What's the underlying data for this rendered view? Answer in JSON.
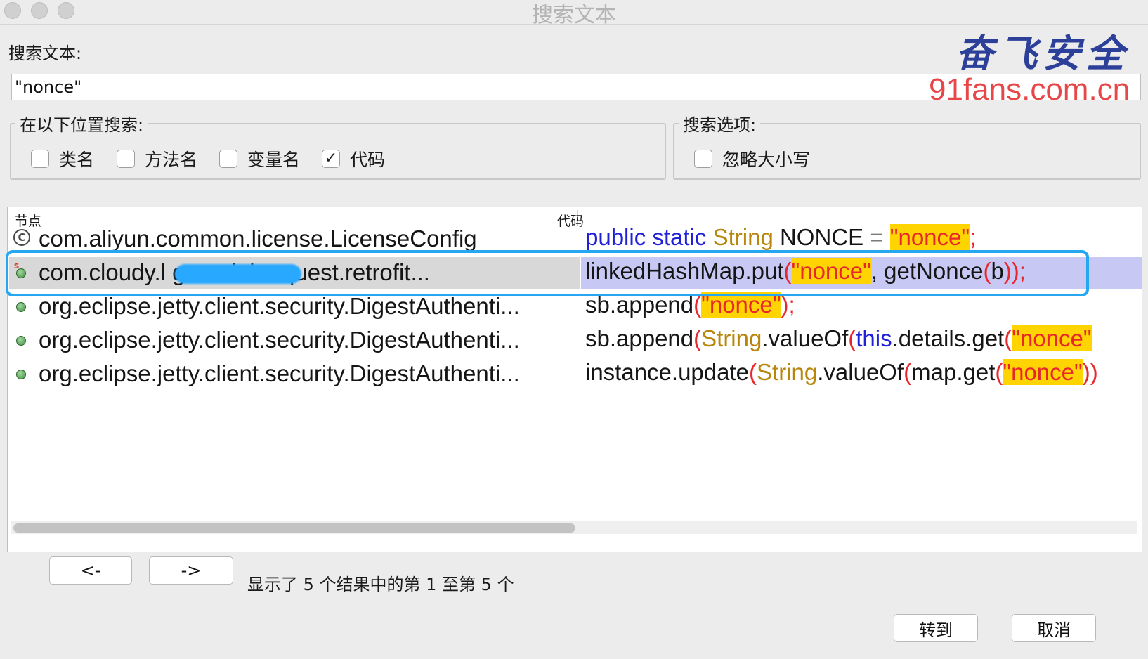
{
  "window": {
    "title": "搜索文本"
  },
  "search": {
    "label": "搜索文本:",
    "value": "\"nonce\""
  },
  "watermark": {
    "brand": "奋飞安全",
    "url": "91fans.com.cn"
  },
  "location_group": {
    "legend": "在以下位置搜索:",
    "options": [
      {
        "label": "类名",
        "checked": false
      },
      {
        "label": "方法名",
        "checked": false
      },
      {
        "label": "变量名",
        "checked": false
      },
      {
        "label": "代码",
        "checked": true
      }
    ]
  },
  "options_group": {
    "legend": "搜索选项:",
    "options": [
      {
        "label": "忽略大小写",
        "checked": false
      }
    ]
  },
  "results": {
    "columns": [
      "节点",
      "代码"
    ],
    "rows": [
      {
        "node": "com.aliyun.common.license.LicenseConfig",
        "icon": "class-icon",
        "code": "public static String NONCE = \"nonce\";",
        "selected": false
      },
      {
        "node": "com.cloudy.l g model.request.retrofit...",
        "icon": "static-method-icon",
        "code": "linkedHashMap.put(\"nonce\", getNonce(b));",
        "selected": true
      },
      {
        "node": "org.eclipse.jetty.client.security.DigestAuthenti...",
        "icon": "method-icon",
        "code": "sb.append(\"nonce\");",
        "selected": false
      },
      {
        "node": "org.eclipse.jetty.client.security.DigestAuthenti...",
        "icon": "method-icon",
        "code": "sb.append(String.valueOf(this.details.get(\"nonce\"",
        "selected": false
      },
      {
        "node": "org.eclipse.jetty.client.security.DigestAuthenti...",
        "icon": "method-icon",
        "code": "instance.update(String.valueOf(map.get(\"nonce\"))",
        "selected": false
      }
    ],
    "code_tokens": [
      [
        {
          "t": "public static ",
          "c": "kw"
        },
        {
          "t": "String ",
          "c": "ty"
        },
        {
          "t": "NONCE ",
          "c": ""
        },
        {
          "t": "= ",
          "c": "op"
        },
        {
          "t": "\"nonce\"",
          "c": "st"
        },
        {
          "t": ";",
          "c": "pn"
        }
      ],
      [
        {
          "t": "linkedHashMap.put",
          "c": ""
        },
        {
          "t": "(",
          "c": "pn"
        },
        {
          "t": "\"nonce\"",
          "c": "st"
        },
        {
          "t": ", getNonce",
          "c": ""
        },
        {
          "t": "(",
          "c": "pn"
        },
        {
          "t": "b",
          "c": ""
        },
        {
          "t": "));",
          "c": "pn"
        }
      ],
      [
        {
          "t": "sb.append",
          "c": ""
        },
        {
          "t": "(",
          "c": "pn"
        },
        {
          "t": "\"nonce\"",
          "c": "st"
        },
        {
          "t": ");",
          "c": "pn"
        }
      ],
      [
        {
          "t": "sb.append",
          "c": ""
        },
        {
          "t": "(",
          "c": "pn"
        },
        {
          "t": "String",
          "c": "ty"
        },
        {
          "t": ".valueOf",
          "c": ""
        },
        {
          "t": "(",
          "c": "pn"
        },
        {
          "t": "this",
          "c": "kw"
        },
        {
          "t": ".details.get",
          "c": ""
        },
        {
          "t": "(",
          "c": "pn"
        },
        {
          "t": "\"nonce\"",
          "c": "st"
        }
      ],
      [
        {
          "t": "instance.update",
          "c": ""
        },
        {
          "t": "(",
          "c": "pn"
        },
        {
          "t": "String",
          "c": "ty"
        },
        {
          "t": ".valueOf",
          "c": ""
        },
        {
          "t": "(",
          "c": "pn"
        },
        {
          "t": "map.get",
          "c": ""
        },
        {
          "t": "(",
          "c": "pn"
        },
        {
          "t": "\"nonce\"",
          "c": "st"
        },
        {
          "t": "))",
          "c": "pn"
        }
      ]
    ]
  },
  "pager": {
    "prev_label": "<-",
    "next_label": "->",
    "status": "显示了 5 个结果中的第 1 至第 5 个"
  },
  "actions": {
    "goto_label": "转到",
    "cancel_label": "取消"
  },
  "colors": {
    "keyword": "#2020d8",
    "type": "#b8860b",
    "string_fg": "#e8272d",
    "string_bg": "#ffd400",
    "selection_code": "#c8c8f4",
    "callout": "#27a6f2"
  }
}
